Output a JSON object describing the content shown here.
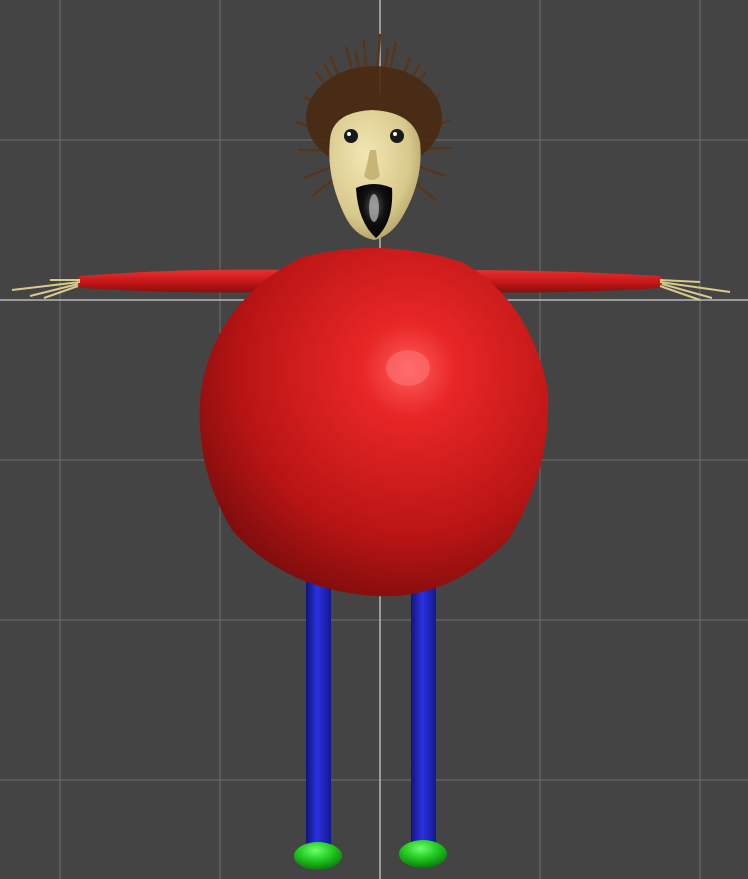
{
  "viewport": {
    "background_color": "#444444",
    "grid_color": "#6e6e6e",
    "axis_color": "#b8b8b8"
  },
  "character": {
    "skin_color": "#d9cc93",
    "hair_color": "#5a3416",
    "body_color": "#d21f1f",
    "arm_color": "#d01c1c",
    "leg_color": "#1c22c8",
    "shoe_color": "#1cc21c",
    "mouth_color": "#111111"
  }
}
